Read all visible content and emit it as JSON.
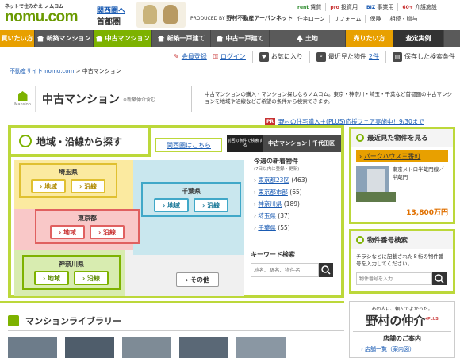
{
  "header": {
    "tagline": "ネットで住みかえ ノムコム",
    "logo": "nomu.com",
    "region_link": "関西圏へ",
    "region": "首都圏",
    "produced_by": "PRODUCED BY",
    "company": "野村不動産アーバンネット",
    "services_row1": [
      {
        "brand": "rent",
        "label": "賃貸"
      },
      {
        "brand": "pro",
        "label": "投資用"
      },
      {
        "brand": "BIZ",
        "label": "事業用"
      },
      {
        "brand": "60+",
        "label": "介護施設"
      }
    ],
    "services_row2": [
      "住宅ローン",
      "リフォーム",
      "保険",
      "相続・贈与"
    ]
  },
  "nav": {
    "buy": "買いたい方",
    "items": [
      "新築マンション",
      "中古マンション",
      "新築一戸建て",
      "中古一戸建て",
      "土地"
    ],
    "sell": "売りたい方",
    "assess": "査定実例"
  },
  "userbar": {
    "register": "会員登録",
    "login": "ログイン",
    "favorites": "お気に入り",
    "recent": "最近見た物件",
    "recent_count": "2件",
    "saved": "保存した検索条件"
  },
  "breadcrumb": {
    "home": "不動産サイト nomu.com",
    "sep": ">",
    "current": "中古マンション"
  },
  "page": {
    "icon_label": "Mansion",
    "title": "中古マンション",
    "subtitle": "※新築仲介含む",
    "description": "中古マンションの購入・マンション探しならノムコム。東京・神奈川・埼玉・千葉など首都圏の中古マンションを地域や沿線などご希望の条件から検索できます。",
    "pr_tag": "PR",
    "pr_text": "野村の住宅購入＋(PLUS)応援フェア実施中！9/30まで"
  },
  "search": {
    "title": "地域・沿線から探す",
    "kansai": "関西圏はこちら",
    "prev_label": "前回の条件で検索する",
    "prev_value": "中古マンション｜千代田区",
    "prefs": [
      {
        "name": "埼玉県",
        "area": "› 地域",
        "line": "› 沿線"
      },
      {
        "name": "東京都",
        "area": "› 地域",
        "line": "› 沿線"
      },
      {
        "name": "千葉県",
        "area": "› 地域",
        "line": "› 沿線"
      },
      {
        "name": "神奈川県",
        "area": "› 地域",
        "line": "› 沿線"
      }
    ],
    "other": "› その他",
    "new_title": "今週の新着物件",
    "new_sub": "(7日以内に登録・更新)",
    "new_items": [
      {
        "label": "東京都23区",
        "count": "(463)"
      },
      {
        "label": "東京都市部",
        "count": "(65)"
      },
      {
        "label": "神奈川県",
        "count": "(189)"
      },
      {
        "label": "埼玉県",
        "count": "(37)"
      },
      {
        "label": "千葉県",
        "count": "(55)"
      }
    ],
    "keyword_title": "キーワード検索",
    "keyword_placeholder": "地名、駅名、物件名"
  },
  "recent_box": {
    "title": "最近見た物件を見る",
    "property": "パークハウス三番町",
    "info": "東京メトロ半蔵門線／半蔵門",
    "price": "13,800万円"
  },
  "number_box": {
    "title": "物件番号検索",
    "desc": "チラシなどに記載された８桁の物件番号を入力してください。",
    "placeholder": "物件番号を入力"
  },
  "ad": {
    "small": "あの人に、頼んでよかった。",
    "brand": "野村の仲介",
    "brand_sup": "+PLUS",
    "store": "店舗のご案内",
    "store_link": "店舗一覧（案内図）"
  },
  "library": {
    "title": "マンションライブラリー"
  },
  "colors": {
    "accent": "#7db200",
    "frame": "#bcd83a",
    "orange": "#e8a000",
    "link": "#1a5bb3"
  }
}
